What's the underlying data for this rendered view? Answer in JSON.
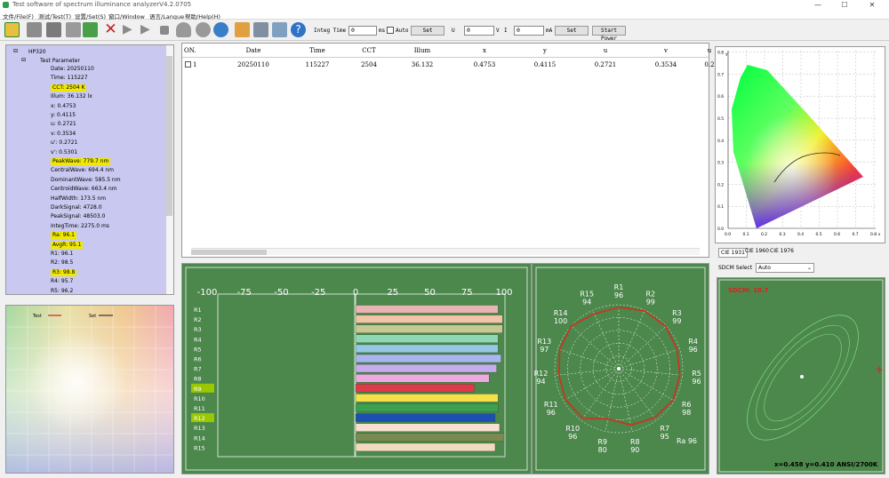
{
  "window": {
    "title": "Test software of spectrum illuminance analyzerV4.2.0705",
    "controls": [
      "—",
      "☐",
      "✕"
    ]
  },
  "menu": [
    "文件/File(F)",
    "测试/Test(T)",
    "设置/Set(S)",
    "窗口/Window",
    "语言/Langue",
    "帮助/Help(H)"
  ],
  "toolbar": {
    "integ_label": "Integ Time",
    "integ_value": "0",
    "integ_unit": "ms",
    "auto_label": "Auto",
    "set1_label": "Set",
    "u_label": "U",
    "u_value": "0",
    "v_label": "V",
    "i_label": "I",
    "i_value": "0",
    "ma_label": "mA",
    "set2_label": "Set",
    "start_power_label": "Start Power"
  },
  "tree": {
    "root": "HP320",
    "group": "Test Parameter",
    "items": [
      {
        "text": "Date: 20250110",
        "hl": false
      },
      {
        "text": "Time: 115227",
        "hl": false
      },
      {
        "text": "CCT: 2504 K",
        "hl": true
      },
      {
        "text": "Illum: 36.132 lx",
        "hl": false
      },
      {
        "text": "x: 0.4753",
        "hl": false
      },
      {
        "text": "y: 0.4115",
        "hl": false
      },
      {
        "text": "u: 0.2721",
        "hl": false
      },
      {
        "text": "v: 0.3534",
        "hl": false
      },
      {
        "text": "u': 0.2721",
        "hl": false
      },
      {
        "text": "v': 0.5301",
        "hl": false
      },
      {
        "text": "PeakWave: 779.7 nm",
        "hl": true
      },
      {
        "text": "CentralWave: 694.4 nm",
        "hl": false
      },
      {
        "text": "DominantWave: 585.5 nm",
        "hl": false
      },
      {
        "text": "CentroidWave: 663.4 nm",
        "hl": false
      },
      {
        "text": "HalfWidth: 173.5 nm",
        "hl": false
      },
      {
        "text": "DarkSignal: 4728.0",
        "hl": false
      },
      {
        "text": "PeakSignal: 48503.0",
        "hl": false
      },
      {
        "text": "IntegTime: 2275.0 ms",
        "hl": false
      },
      {
        "text": "Ra: 96.1",
        "hl": true
      },
      {
        "text": "AvgR: 95.1",
        "hl": true
      },
      {
        "text": "R1: 96.1",
        "hl": false
      },
      {
        "text": "R2: 98.5",
        "hl": false
      },
      {
        "text": "R3: 98.8",
        "hl": true
      },
      {
        "text": "R4: 95.7",
        "hl": false
      },
      {
        "text": "R5: 96.2",
        "hl": false
      }
    ]
  },
  "colorpanel": {
    "legend_test": "Test",
    "legend_set": "Set"
  },
  "table": {
    "columns": [
      "ON.",
      "Date",
      "Time",
      "CCT",
      "Illum",
      "x",
      "y",
      "u",
      "v",
      "u"
    ],
    "rows": [
      [
        "1",
        "20250110",
        "115227",
        "2504",
        "36.132",
        "0.4753",
        "0.4115",
        "0.2721",
        "0.3534",
        "0.2"
      ]
    ]
  },
  "cie": {
    "xticks": [
      "0.0",
      "0.1",
      "0.2",
      "0.3",
      "0.4",
      "0.5",
      "0.6",
      "0.7",
      "0.8 x"
    ],
    "yticks": [
      "0.0",
      "0.1",
      "0.2",
      "0.3",
      "0.4",
      "0.5",
      "0.6",
      "0.7",
      "0.8"
    ],
    "yaxis_label": "y",
    "tabs": [
      "CIE 1931",
      "CIE 1960",
      "CIE 1976"
    ]
  },
  "sdcm": {
    "select_label": "SDCM Select",
    "select_value": "Auto",
    "value_text": "SDCM: 10.7",
    "coord_text": "x=0.458 y=0.410 ANSI/2700K"
  },
  "chart_data": [
    {
      "type": "bar",
      "orientation": "horizontal",
      "axis_ticks": [
        "-100",
        "-75",
        "-50",
        "-25",
        "0",
        "25",
        "50",
        "75",
        "100"
      ],
      "xlim": [
        -100,
        100
      ],
      "categories": [
        "R1",
        "R2",
        "R3",
        "R4",
        "R5",
        "R6",
        "R7",
        "R8",
        "R9",
        "R10",
        "R11",
        "R12",
        "R13",
        "R14",
        "R15"
      ],
      "values": [
        96,
        99,
        99,
        96,
        96,
        98,
        95,
        90,
        80,
        96,
        96,
        94,
        97,
        100,
        94
      ],
      "highlighted": [
        "R9",
        "R12"
      ],
      "colors": [
        "#e8b4b4",
        "#f2c3a8",
        "#c8c896",
        "#8fd8b4",
        "#96c8e6",
        "#aab4ee",
        "#c8aaee",
        "#eeaae0",
        "#e03a4a",
        "#f4e04a",
        "#3ca050",
        "#1c50b0",
        "#f8e0d0",
        "#7a8a50",
        "#f4d8c0"
      ]
    },
    {
      "type": "radar",
      "categories": [
        "R1",
        "R2",
        "R3",
        "R4",
        "R5",
        "R6",
        "R7",
        "R8",
        "R9",
        "R10",
        "R11",
        "R12",
        "R13",
        "R14",
        "R15"
      ],
      "values": [
        96,
        99,
        99,
        96,
        96,
        98,
        95,
        90,
        80,
        96,
        96,
        94,
        97,
        100,
        94
      ],
      "ra_label": "Ra 96"
    }
  ]
}
